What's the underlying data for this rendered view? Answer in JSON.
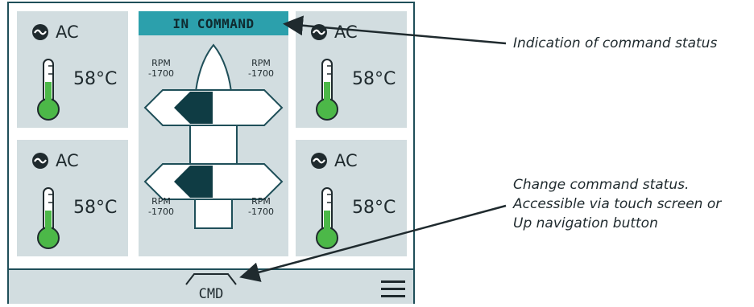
{
  "tiles": [
    {
      "ac_label": "AC",
      "temperature": "58°C"
    },
    {
      "ac_label": "AC",
      "temperature": "58°C"
    },
    {
      "ac_label": "AC",
      "temperature": "58°C"
    },
    {
      "ac_label": "AC",
      "temperature": "58°C"
    }
  ],
  "center": {
    "status_banner": "IN COMMAND",
    "rpm_top_left": {
      "label": "RPM",
      "value": "-1700"
    },
    "rpm_top_right": {
      "label": "RPM",
      "value": "-1700"
    },
    "rpm_bottom_left": {
      "label": "RPM",
      "value": "-1700"
    },
    "rpm_bottom_right": {
      "label": "RPM",
      "value": "-1700"
    }
  },
  "bottom_bar": {
    "cmd_label": "CMD",
    "menu_icon": "hamburger-menu-icon"
  },
  "callouts": {
    "command_status": "Indication of command status",
    "change_command": [
      "Change command status.",
      "Accessible via touch screen or",
      "Up navigation button"
    ]
  },
  "colors": {
    "panel_border": "#1f4f59",
    "tile_bg": "#d2dde0",
    "banner_bg": "#2ca0ac",
    "thermo_fill": "#4cb848",
    "thrust_dark": "#0f3c44"
  }
}
